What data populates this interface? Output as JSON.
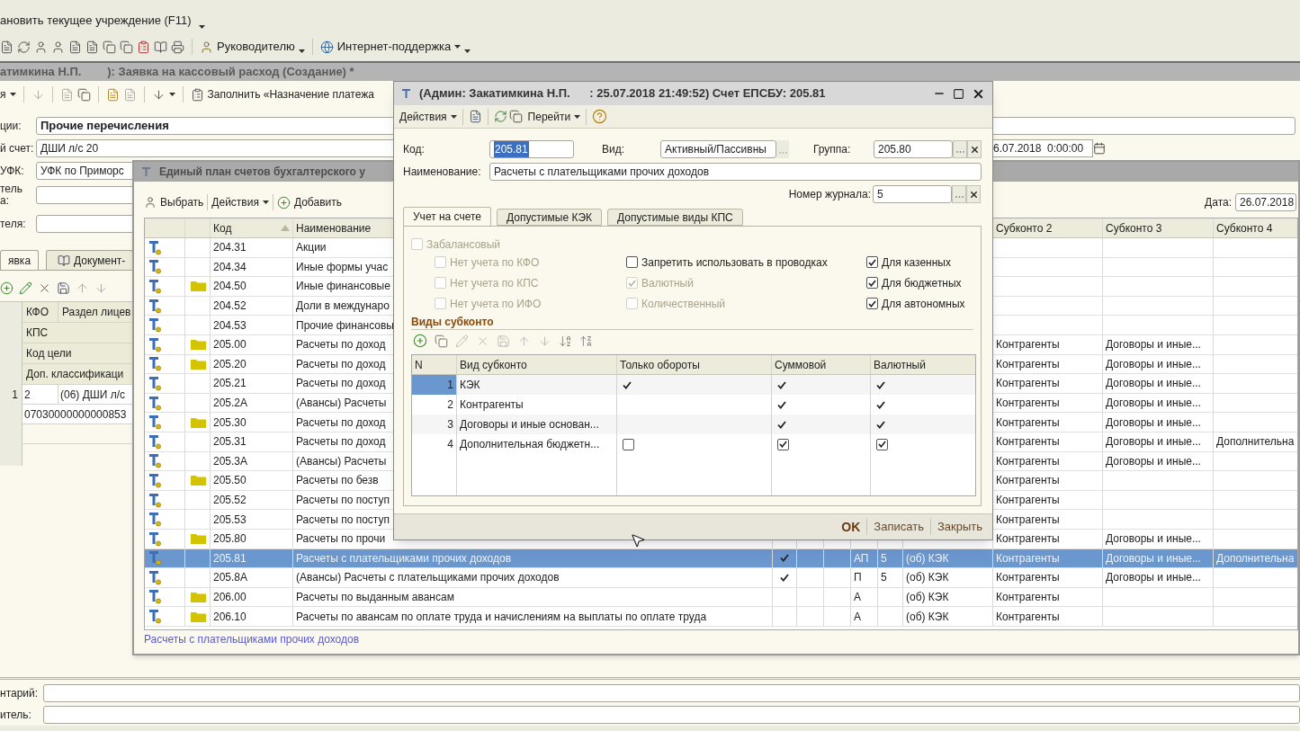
{
  "top_toolbar": {
    "menu_item": "ановить текущее учреждение (F11)",
    "manager_button": "Руководителю",
    "support_button": "Интернет-поддержка"
  },
  "document_window": {
    "title": "атимкина Н.П.        ): Заявка на кассовый расход (Создание) *",
    "actions_menu": "я",
    "fill_button": "Заполнить «Назначение платежа",
    "fields": [
      {
        "label": "ции:",
        "value": "Прочие перечисления",
        "bold": true
      },
      {
        "label": "й счет:",
        "value": "ДШИ л/с 20",
        "bold": false
      },
      {
        "label": "УФК:",
        "value": "УФК по Приморс",
        "bold": false
      }
    ],
    "empty_fields": [
      {
        "label_lines": [
          "тель",
          "а:"
        ]
      },
      {
        "label_lines": [
          "теля:"
        ]
      }
    ],
    "date": "6.07.2018  0:00:00",
    "tabs": [
      {
        "label": "явка",
        "selected": true
      },
      {
        "label": "Документ-",
        "selected": false
      }
    ],
    "table": {
      "header": [
        [
          "КФО",
          "Раздел лицев"
        ],
        [
          "КПС"
        ],
        [
          "Код цели"
        ],
        [
          "Доп. классификаци"
        ]
      ],
      "row_number": "1",
      "row_lines": [
        [
          "2",
          "(06) ДШИ л/с"
        ],
        [
          "07030000000000853"
        ]
      ]
    },
    "bottom_fields": [
      {
        "label": "нтарий:"
      },
      {
        "label": "итель:"
      }
    ]
  },
  "list_window": {
    "title": "Единый план счетов бухгалтерского у",
    "select_button": "Выбрать",
    "actions_menu": "Действия",
    "add_button": "Добавить",
    "date_label": "Дата:",
    "date_value": "26.07.2018",
    "columns": {
      "code": "Код",
      "name": "Наименование",
      "sub2": "Субконто 2",
      "sub3": "Субконто 3",
      "sub4": "Субконто 4"
    },
    "rows": [
      {
        "code": "204.31",
        "name": "Акции",
        "folder": false,
        "selected": false
      },
      {
        "code": "204.34",
        "name": "Иные формы учас",
        "folder": false,
        "selected": false
      },
      {
        "code": "204.50",
        "name": "Иные финансовые",
        "folder": true,
        "selected": false
      },
      {
        "code": "204.52",
        "name": "Доли в междунаро",
        "folder": false,
        "selected": false
      },
      {
        "code": "204.53",
        "name": "Прочие финансовы",
        "folder": false,
        "selected": false
      },
      {
        "code": "205.00",
        "name": "Расчеты по доход",
        "folder": true,
        "selected": false,
        "sub2": "Контрагенты",
        "sub3": "Договоры и иные..."
      },
      {
        "code": "205.20",
        "name": "Расчеты по доход",
        "folder": true,
        "selected": false,
        "sub2": "Контрагенты",
        "sub3": "Договоры и иные..."
      },
      {
        "code": "205.21",
        "name": "Расчеты по доход",
        "folder": false,
        "selected": false,
        "sub2": "Контрагенты",
        "sub3": "Договоры и иные..."
      },
      {
        "code": "205.2A",
        "name": "(Авансы) Расчеты",
        "folder": false,
        "selected": false,
        "sub2": "Контрагенты",
        "sub3": "Договоры и иные..."
      },
      {
        "code": "205.30",
        "name": "Расчеты по доход",
        "folder": true,
        "selected": false,
        "sub2": "Контрагенты",
        "sub3": "Договоры и иные..."
      },
      {
        "code": "205.31",
        "name": "Расчеты по доход",
        "folder": false,
        "selected": false,
        "sub2": "Контрагенты",
        "sub3": "Договоры и иные...",
        "sub4": "Дополнительна"
      },
      {
        "code": "205.3A",
        "name": "(Авансы) Расчеты",
        "folder": false,
        "selected": false,
        "sub2": "Контрагенты",
        "sub3": "Договоры и иные..."
      },
      {
        "code": "205.50",
        "name": "Расчеты по  безв",
        "folder": true,
        "selected": false,
        "sub2": "Контрагенты"
      },
      {
        "code": "205.52",
        "name": "Расчеты по поступ",
        "folder": false,
        "selected": false,
        "sub2": "Контрагенты"
      },
      {
        "code": "205.53",
        "name": "Расчеты по поступ",
        "folder": false,
        "selected": false,
        "sub2": "Контрагенты"
      },
      {
        "code": "205.80",
        "name": "Расчеты по прочи",
        "folder": true,
        "selected": false,
        "sub2": "Контрагенты",
        "sub3": "Договоры и иные..."
      },
      {
        "code": "205.81",
        "name": "Расчеты с плательщиками прочих доходов",
        "folder": false,
        "selected": true,
        "check": true,
        "type": "АП",
        "number": "5",
        "analytics": "(об) КЭК",
        "sub2": "Контрагенты",
        "sub3": "Договоры и иные...",
        "sub4": "Дополнительна"
      },
      {
        "code": "205.8A",
        "name": "(Авансы) Расчеты с плательщиками прочих доходов",
        "folder": false,
        "selected": false,
        "check": true,
        "type": "П",
        "number": "5",
        "analytics": "(об) КЭК",
        "sub2": "Контрагенты",
        "sub3": "Договоры и иные..."
      },
      {
        "code": "206.00",
        "name": "Расчеты по выданным авансам",
        "folder": true,
        "selected": false,
        "check": false,
        "type": "А",
        "analytics": "(об) КЭК",
        "sub2": "Контрагенты"
      },
      {
        "code": "206.10",
        "name": "Расчеты по авансам по оплате труда и начислениям на выплаты по оплате труда",
        "folder": true,
        "selected": false,
        "check": false,
        "type": "А",
        "analytics": "(об) КЭК",
        "sub2": "Контрагенты"
      }
    ],
    "status": "Расчеты с плательщиками прочих доходов"
  },
  "dialog": {
    "title": "(Админ: Закатимкина Н.П.      : 25.07.2018 21:49:52) Счет ЕПСБУ: 205.81",
    "actions_menu": "Действия",
    "goto_menu": "Перейти",
    "code_label": "Код:",
    "code": "205.81",
    "kind_label": "Вид:",
    "kind": "Активный/Пассивны",
    "group_label": "Группа:",
    "group": "205.80",
    "name_label": "Наименование:",
    "name": "Расчеты с плательщиками прочих доходов",
    "journal_label": "Номер журнала:",
    "journal": "5",
    "tabs": [
      {
        "label": "Учет на счете",
        "selected": true
      },
      {
        "label": "Допустимые КЭК",
        "selected": false
      },
      {
        "label": "Допустимые виды КПС",
        "selected": false
      }
    ],
    "off_balance": {
      "label": "Забалансовый",
      "checked": false,
      "disabled": true
    },
    "checkbox_columns": [
      [
        {
          "label": "Нет учета по КФО",
          "checked": false,
          "disabled": true
        },
        {
          "label": "Нет учета по КПС",
          "checked": false,
          "disabled": true
        },
        {
          "label": "Нет учета по ИФО",
          "checked": false,
          "disabled": true
        }
      ],
      [
        {
          "label": "Запретить использовать в проводках",
          "checked": false,
          "disabled": false
        },
        {
          "label": "Валютный",
          "checked": true,
          "disabled": true
        },
        {
          "label": "Количественный",
          "checked": false,
          "disabled": true
        }
      ],
      [
        {
          "label": "Для казенных",
          "checked": true,
          "disabled": false
        },
        {
          "label": "Для бюджетных",
          "checked": true,
          "disabled": false
        },
        {
          "label": "Для автономных",
          "checked": true,
          "disabled": false
        }
      ]
    ],
    "subconto_title": "Виды субконто",
    "table": {
      "columns": [
        "N",
        "Вид субконто",
        "Только обороты",
        "Суммовой",
        "Валютный"
      ],
      "rows": [
        {
          "n": "1",
          "name": "КЭК",
          "kind": "checkmark",
          "turnover_only": true,
          "amount": true,
          "currency": true,
          "selected": true
        },
        {
          "n": "2",
          "name": "Контрагенты",
          "kind": "checkmark",
          "turnover_only": false,
          "amount": true,
          "currency": true,
          "selected": false
        },
        {
          "n": "3",
          "name": "Договоры и иные основан...",
          "kind": "checkmark",
          "turnover_only": false,
          "amount": true,
          "currency": true,
          "selected": false
        },
        {
          "n": "4",
          "name": "Дополнительная бюджетн...",
          "kind": "checkbox",
          "turnover_only": false,
          "amount": true,
          "currency": true,
          "selected": false
        }
      ]
    },
    "buttons": [
      {
        "label": "OK",
        "default": true
      },
      {
        "label": "Записать",
        "default": false
      },
      {
        "label": "Закрыть",
        "default": false
      }
    ]
  }
}
